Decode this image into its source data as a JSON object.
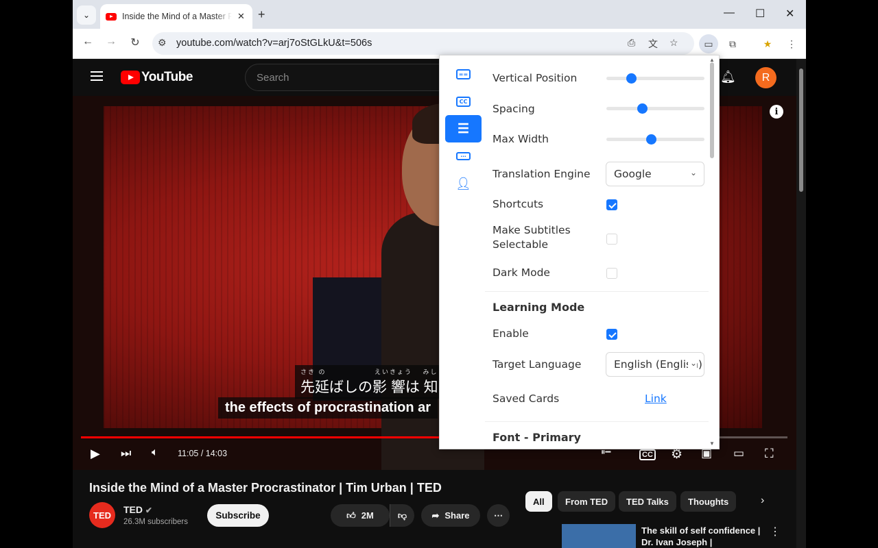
{
  "browser": {
    "tab_title": "Inside the Mind of a Master Procrastinator | Tim Urban | TED - YouTube",
    "url": "youtube.com/watch?v=arj7oStGLkU&t=506s"
  },
  "youtube": {
    "logo_text": "YouTube",
    "search_placeholder": "Search",
    "avatar_letter": "R",
    "video": {
      "subtitle_ruby": "さき の 　　　　　　えいきょう 　みし",
      "subtitle_primary": "先延ばしの影 響は 知",
      "subtitle_secondary": "the effects of procrastination ar",
      "time": "11:05 / 14:03",
      "progress": 0.789
    },
    "title": "Inside the Mind of a Master Procrastinator | Tim Urban | TED",
    "channel": {
      "logo": "TED",
      "name": "TED",
      "subscribers": "26.3M subscribers"
    },
    "subscribe_label": "Subscribe",
    "likes": "2M",
    "share_label": "Share",
    "chips": [
      "All",
      "From TED",
      "TED Talks",
      "Thoughts"
    ],
    "recommendation_title": "The skill of self confidence | Dr. Ivan Joseph |"
  },
  "popup": {
    "settings": {
      "vertical_position": {
        "label": "Vertical Position",
        "value": 0.23
      },
      "spacing": {
        "label": "Spacing",
        "value": 0.35
      },
      "max_width": {
        "label": "Max Width",
        "value": 0.45
      },
      "translation_engine": {
        "label": "Translation Engine",
        "value": "Google"
      },
      "shortcuts": {
        "label": "Shortcuts",
        "checked": true
      },
      "selectable_line1": "Make Subtitles",
      "selectable_line2": "Selectable",
      "dark_mode": {
        "label": "Dark Mode",
        "checked": false
      }
    },
    "learning": {
      "section_title": "Learning Mode",
      "enable": {
        "label": "Enable",
        "checked": true
      },
      "target_language": {
        "label": "Target Language",
        "value": "English (English)"
      },
      "saved_cards": {
        "label": "Saved Cards",
        "link": "Link"
      }
    },
    "font_section_title": "Font - Primary",
    "accent_color": "#1677ff"
  }
}
